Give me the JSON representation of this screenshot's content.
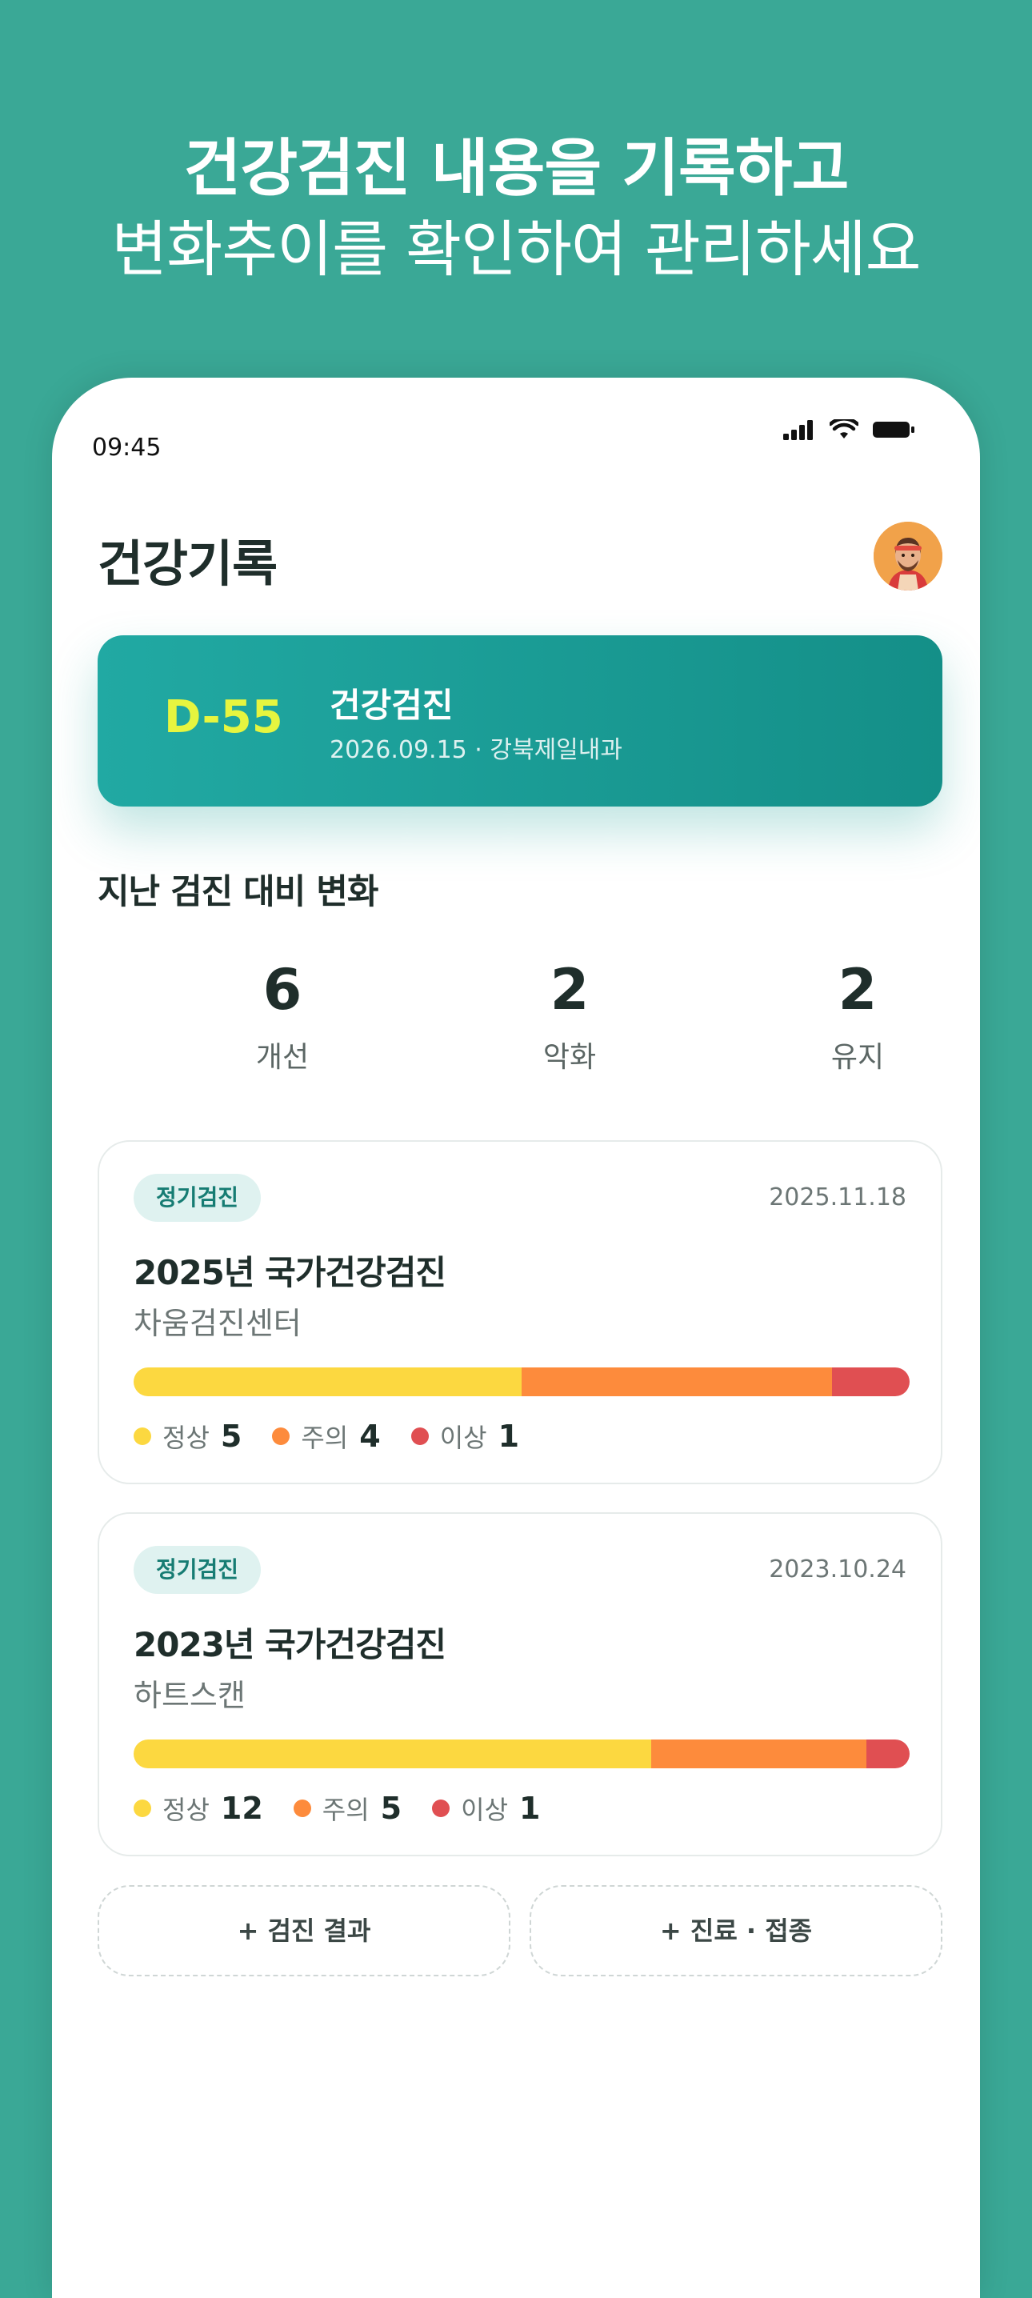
{
  "promo": {
    "line1": "건강검진 내용을 기록하고",
    "line2": "변화추이를 확인하여 관리하세요"
  },
  "status_bar": {
    "time": "09:45",
    "icons": [
      "signal-icon",
      "wifi-icon",
      "battery-icon"
    ]
  },
  "header": {
    "title": "건강기록",
    "avatar": "avatar-icon"
  },
  "upcoming": {
    "dday": "D-55",
    "title": "건강검진",
    "detail": "2026.09.15 · 강북제일내과"
  },
  "comparison": {
    "title": "지난 검진 대비 변화",
    "stats": [
      {
        "value": "6",
        "label": "개선"
      },
      {
        "value": "2",
        "label": "악화"
      },
      {
        "value": "2",
        "label": "유지"
      }
    ]
  },
  "records": [
    {
      "badge": "정기검진",
      "date": "2025.11.18",
      "title": "2025년 국가건강검진",
      "place": "차움검진센터",
      "counts": {
        "normal": 5,
        "caution": 4,
        "abnormal": 1
      },
      "legend": [
        {
          "label": "정상",
          "value": "5"
        },
        {
          "label": "주의",
          "value": "4"
        },
        {
          "label": "이상",
          "value": "1"
        }
      ]
    },
    {
      "badge": "정기검진",
      "date": "2023.10.24",
      "title": "2023년 국가건강검진",
      "place": "하트스캔",
      "counts": {
        "normal": 12,
        "caution": 5,
        "abnormal": 1
      },
      "legend": [
        {
          "label": "정상",
          "value": "12"
        },
        {
          "label": "주의",
          "value": "5"
        },
        {
          "label": "이상",
          "value": "1"
        }
      ]
    }
  ],
  "actions": {
    "add_result": "+ 검진 결과",
    "add_visit": "+ 진료 · 접종"
  },
  "colors": {
    "background": "#3aa896",
    "normal": "#fcd840",
    "caution": "#fd8b3c",
    "abnormal": "#e04f52",
    "dday": "#e6f53f",
    "card_gradient_start": "#21a9a3",
    "card_gradient_end": "#148f88"
  }
}
